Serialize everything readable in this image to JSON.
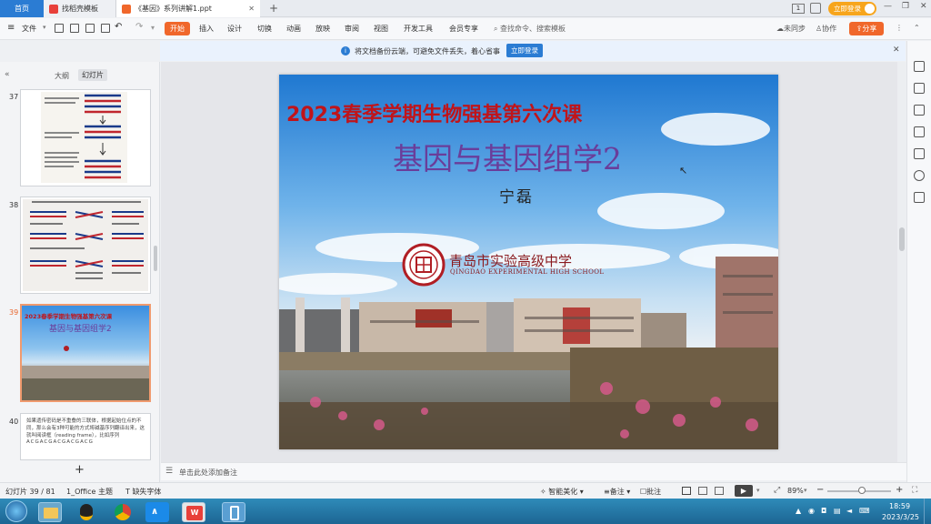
{
  "tabs": {
    "home": "首页",
    "template": "找稻壳模板",
    "document": "《基因》系列讲解1.ppt",
    "add": "+"
  },
  "titlebar": {
    "page_indicator": "1",
    "login_button": "立即登录"
  },
  "toolbar": {
    "file": "文件",
    "start": "开始",
    "menus": [
      "插入",
      "设计",
      "切换",
      "动画",
      "放映",
      "审阅",
      "视图",
      "开发工具",
      "会员专享"
    ],
    "search_placeholder": "查找命令、搜索模板",
    "sync": "未同步",
    "collab": "协作",
    "share": "分享"
  },
  "notify": {
    "message": "将文档备份云端，可避免文件丢失，着心省事",
    "button": "立即登录"
  },
  "panel": {
    "tab_outline": "大纲",
    "tab_slides": "幻灯片",
    "slides": [
      {
        "num": "37"
      },
      {
        "num": "38"
      },
      {
        "num": "39",
        "title": "2023春季学期生物强基第六次课",
        "subtitle": "基因与基因组学2"
      },
      {
        "num": "40",
        "text": "如果遗传密码是不重叠的三联体，根据起始位点的不同，那么会有3种可能的方式将碱基序列翻译出来，这就叫阅读框（reading frame），比如序列",
        "seq": "ACGACGACGACGACG"
      }
    ],
    "add_slide": "+"
  },
  "slide": {
    "title": "2023春季学期生物强基第六次课",
    "subtitle": "基因与基因组学2",
    "author": "宁磊",
    "school_cn": "青岛市实验高级中学",
    "school_en": "QINGDAO EXPERIMENTAL HIGH SCHOOL"
  },
  "notes_placeholder": "单击此处添加备注",
  "status": {
    "slide_count": "幻灯片 39 / 81",
    "theme": "1_Office 主题",
    "missing_font": "缺失字体",
    "smart_beautify": "智能美化",
    "notes": "备注",
    "comments": "批注",
    "zoom": "89%"
  },
  "taskbar": {
    "time": "18:59",
    "date": "2023/3/25"
  },
  "colors": {
    "title_red": "#c0141a",
    "subtitle_purple": "#6a3d9a",
    "wps_orange": "#f0672b",
    "accent_blue": "#2b7cd3"
  }
}
